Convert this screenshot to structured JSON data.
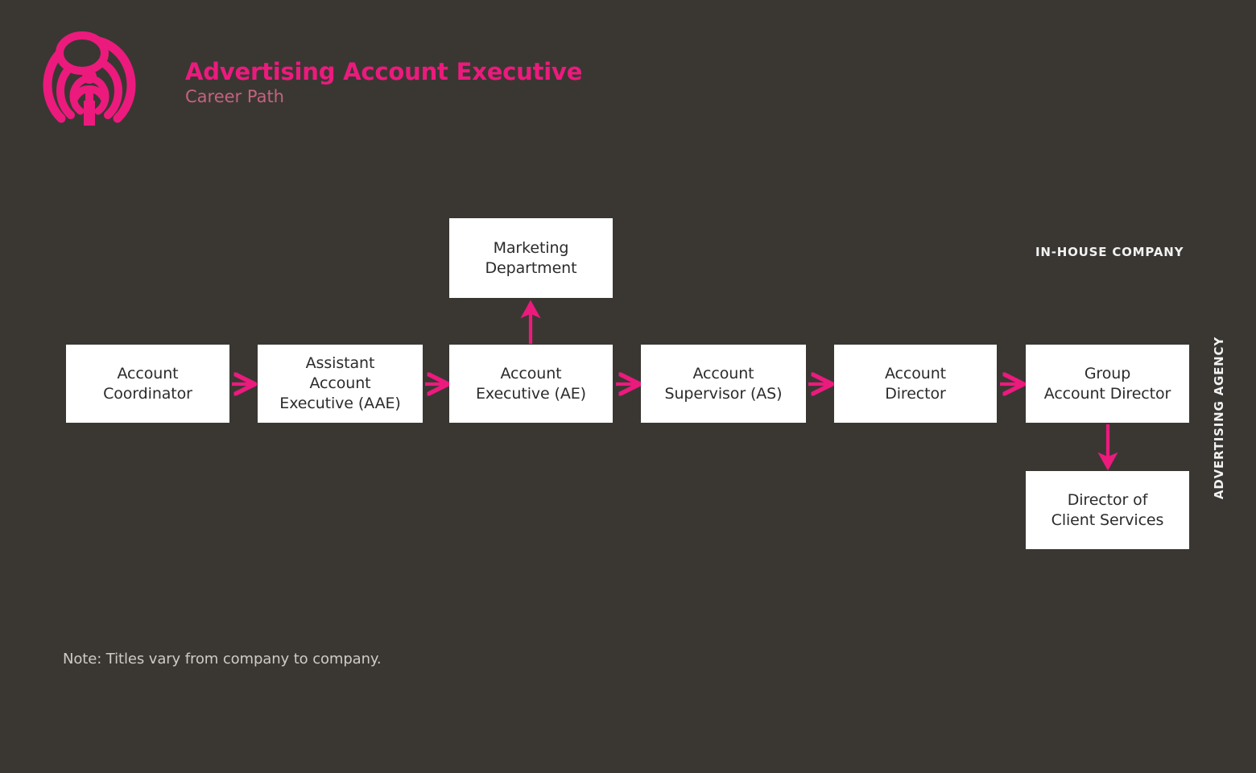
{
  "page": {
    "background_color": "#3a3733",
    "accent_color": "#ec1a7d",
    "node_fill_color": "#ffffff",
    "node_text_color": "#2b2b2b"
  },
  "header": {
    "logo_name": "person-broadcast-speech-bubble-logo",
    "title": "Advertising Account Executive",
    "subtitle": "Career Path"
  },
  "diagram": {
    "nodes": [
      {
        "id": "account-coordinator",
        "label": "Account\nCoordinator"
      },
      {
        "id": "assistant-account-executive",
        "label": "Assistant\nAccount\nExecutive (AAE)"
      },
      {
        "id": "account-executive",
        "label": "Account\nExecutive (AE)"
      },
      {
        "id": "marketing-department",
        "label": "Marketing\nDepartment"
      },
      {
        "id": "account-supervisor",
        "label": "Account\nSupervisor (AS)"
      },
      {
        "id": "account-director",
        "label": "Account\nDirector"
      },
      {
        "id": "group-account-director",
        "label": "Group\nAccount Director"
      },
      {
        "id": "director-of-client-services",
        "label": "Director of\nClient Services"
      }
    ],
    "edges": [
      {
        "from": "account-coordinator",
        "to": "assistant-account-executive",
        "direction": "right"
      },
      {
        "from": "assistant-account-executive",
        "to": "account-executive",
        "direction": "right"
      },
      {
        "from": "account-executive",
        "to": "account-supervisor",
        "direction": "right"
      },
      {
        "from": "account-executive",
        "to": "marketing-department",
        "direction": "up"
      },
      {
        "from": "account-supervisor",
        "to": "account-director",
        "direction": "right"
      },
      {
        "from": "account-director",
        "to": "group-account-director",
        "direction": "right"
      },
      {
        "from": "group-account-director",
        "to": "director-of-client-services",
        "direction": "down"
      }
    ]
  },
  "labels": {
    "in_house_company": "IN-HOUSE COMPANY",
    "advertising_agency": "ADVERTISING AGENCY"
  },
  "footnote": {
    "note": "Note: Titles vary from company to company."
  }
}
